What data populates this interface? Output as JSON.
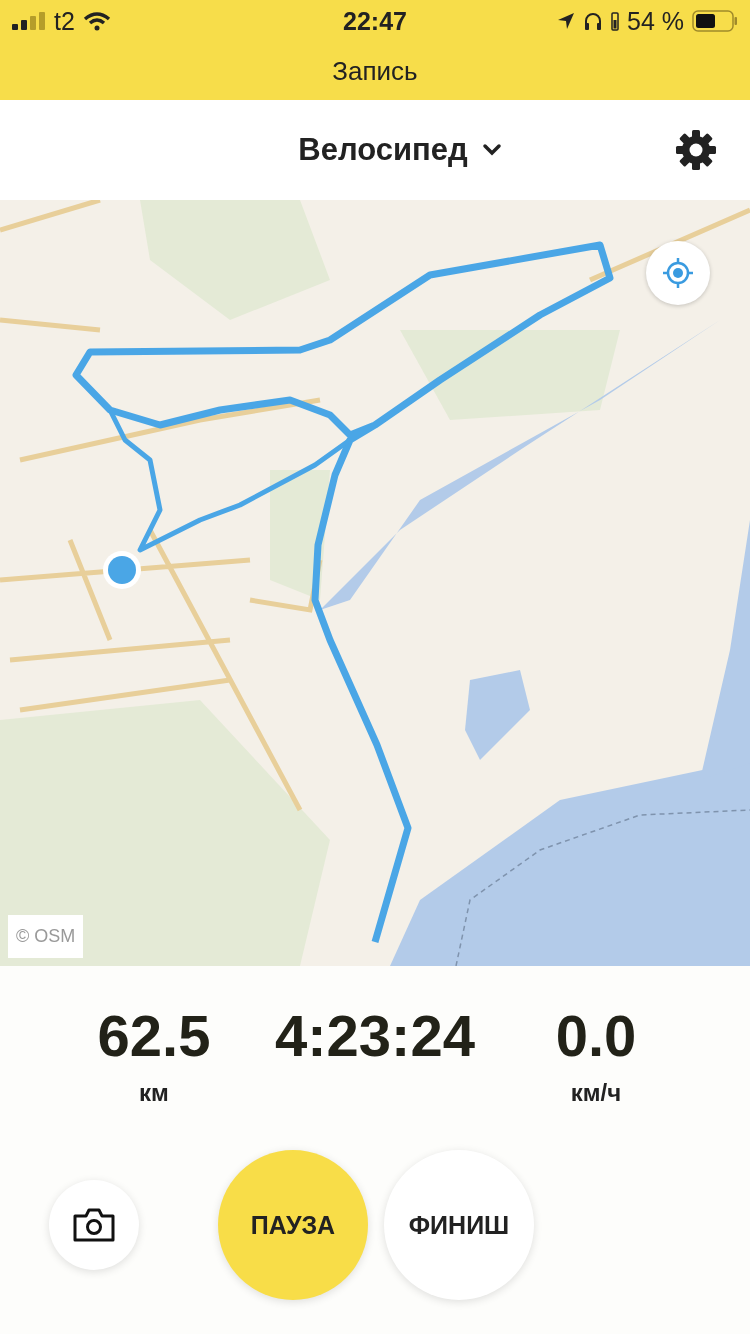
{
  "status_bar": {
    "carrier": "t2",
    "time": "22:47",
    "battery": "54 %"
  },
  "title_bar": {
    "title": "Запись"
  },
  "header": {
    "activity": "Велосипед"
  },
  "map": {
    "attribution": "© OSM"
  },
  "stats": [
    {
      "value": "62.5",
      "unit": "км"
    },
    {
      "value": "4:23:24"
    },
    {
      "value": "0.0",
      "unit": "км/ч"
    }
  ],
  "buttons": {
    "pause": "ПАУЗА",
    "finish": "ФИНИШ"
  }
}
